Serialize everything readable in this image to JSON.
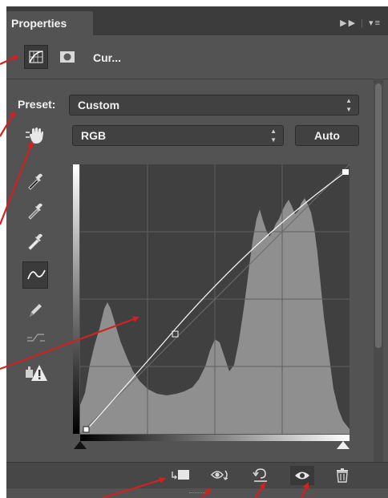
{
  "panel": {
    "tab_label": "Properties",
    "menu_icon": "panel-menu-icon",
    "collapse_icon": "double-arrow-icon"
  },
  "header": {
    "adjustment_title": "Cur...",
    "curves_icon": "curves-adjustment-icon",
    "mask_icon": "layer-mask-icon"
  },
  "preset": {
    "label": "Preset:",
    "value": "Custom"
  },
  "channel": {
    "value": "RGB"
  },
  "auto_button": {
    "label": "Auto"
  },
  "tools": [
    {
      "name": "on-image-adjust-icon"
    },
    {
      "name": "black-point-eyedropper-icon"
    },
    {
      "name": "gray-point-eyedropper-icon"
    },
    {
      "name": "white-point-eyedropper-icon"
    },
    {
      "name": "curve-points-icon"
    },
    {
      "name": "pencil-draw-icon"
    },
    {
      "name": "smooth-curve-icon"
    },
    {
      "name": "clipping-warning-icon"
    }
  ],
  "bottom_bar": [
    {
      "name": "clip-to-layer-icon"
    },
    {
      "name": "view-previous-state-icon"
    },
    {
      "name": "reset-adjustments-icon"
    },
    {
      "name": "toggle-visibility-icon"
    },
    {
      "name": "delete-adjustment-icon"
    }
  ],
  "colors": {
    "panel_bg": "#535353",
    "graph_bg": "#404040",
    "histogram": "#8e8e8e",
    "annotation_arrow": "#d42020"
  }
}
